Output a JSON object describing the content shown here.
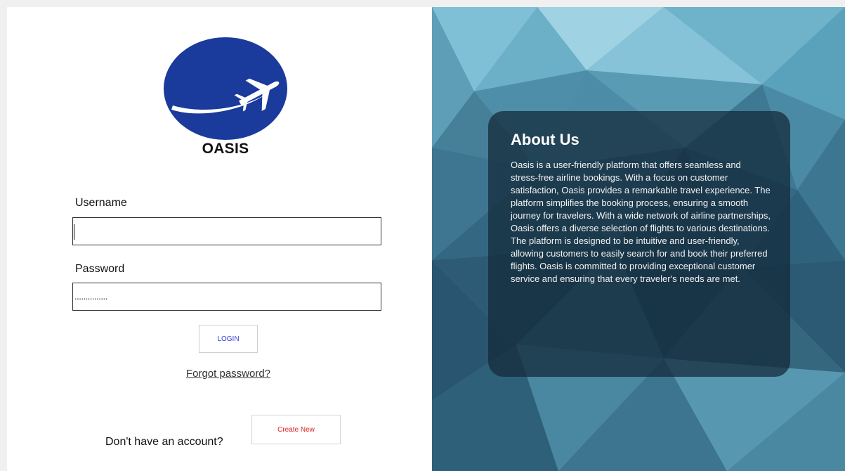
{
  "brand": {
    "name": "OASIS",
    "logo_icon": "airplane-logo-icon",
    "logo_color": "#1a3a9c"
  },
  "login_form": {
    "username_label": "Username",
    "username_value": "",
    "password_label": "Password",
    "password_mask": "...............",
    "login_button": "LOGIN",
    "forgot_link": "Forgot password?",
    "no_account_text": "Don't have an account?",
    "create_button": "Create New"
  },
  "about": {
    "title": "About Us",
    "body": "Oasis is a user-friendly platform that offers seamless and stress-free airline bookings. With a focus on customer satisfaction, Oasis provides a remarkable travel experience. The platform simplifies the booking process, ensuring a smooth journey for travelers. With a wide network of airline partnerships, Oasis offers a diverse selection of flights to various destinations. The platform is designed to be intuitive and user-friendly, allowing customers to easily search for and book their preferred flights. Oasis is committed to providing exceptional customer service and ensuring that every traveler's needs are met."
  },
  "colors": {
    "login_text": "#3a3ad8",
    "create_text": "#e02020",
    "panel_bg": "#5e9fb5"
  }
}
